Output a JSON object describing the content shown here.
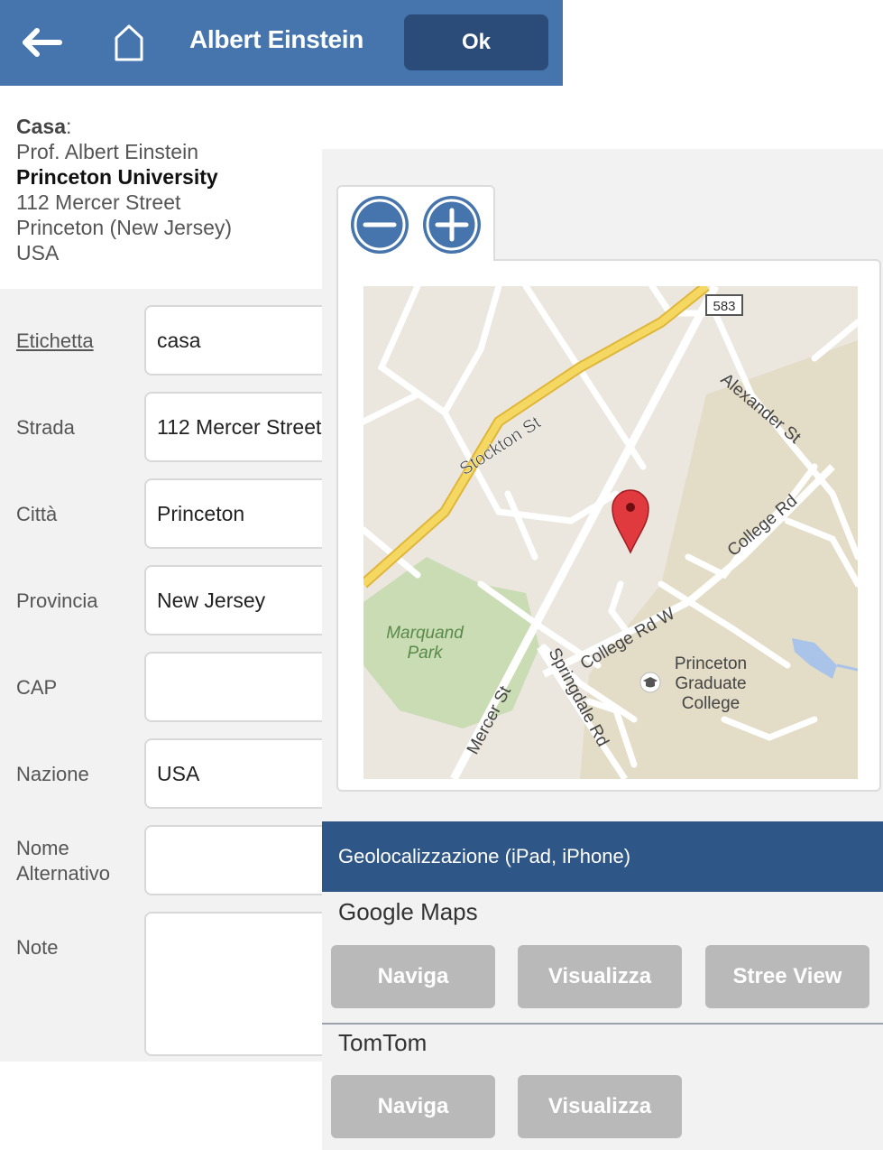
{
  "header": {
    "title": "Albert Einstein",
    "ok_label": "Ok",
    "bar_color": "#4575ac"
  },
  "address": {
    "label": "Casa",
    "colon": ":",
    "name": "Prof. Albert Einstein",
    "organization": "Princeton University",
    "street": "112 Mercer Street",
    "city_state": "Princeton (New Jersey)",
    "country": "USA"
  },
  "form": {
    "label_field": {
      "label": "Etichetta",
      "value": "casa"
    },
    "street_field": {
      "label": "Strada",
      "value": "112 Mercer Street"
    },
    "city_field": {
      "label": "Città",
      "value": "Princeton"
    },
    "province_field": {
      "label": "Provincia",
      "value": "New Jersey"
    },
    "cap_field": {
      "label": "CAP",
      "value": ""
    },
    "country_field": {
      "label": "Nazione",
      "value": "USA"
    },
    "alt_name_field": {
      "label_line1": "Nome",
      "label_line2": "Alternativo",
      "value": ""
    },
    "notes_field": {
      "label": "Note",
      "value": ""
    }
  },
  "map": {
    "labels": {
      "stockton": "Stockton St",
      "alexander": "Alexander St",
      "college_rd": "College Rd",
      "college_rd_w": "College Rd W",
      "mercer": "Mercer St",
      "springdale": "Springdale Rd",
      "park_line1": "Marquand",
      "park_line2": "Park",
      "college_line1": "Princeton",
      "college_line2": "Graduate",
      "college_line3": "College",
      "route_shield": "583"
    },
    "zoom_out_icon": "minus-icon",
    "zoom_in_icon": "plus-icon",
    "marker_icon": "map-pin-icon"
  },
  "geolocation": {
    "bar_label": "Geolocalizzazione (iPad, iPhone)",
    "bar_color": "#2e5686",
    "google_maps": {
      "title": "Google Maps",
      "navigate": "Naviga",
      "view": "Visualizza",
      "street_view": "Stree View"
    },
    "tomtom": {
      "title": "TomTom",
      "navigate": "Naviga",
      "view": "Visualizza"
    }
  }
}
